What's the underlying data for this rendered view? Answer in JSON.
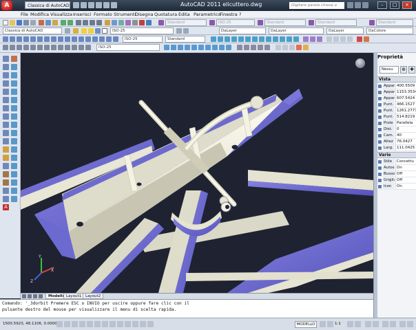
{
  "titlebar": {
    "app_button": "A",
    "workspace": "Classica di AutoCAD",
    "title": "AutoCAD 2011    elicuttero.dwg",
    "search_placeholder": "Digitare parola chiave o frase",
    "window_buttons": [
      "–",
      "□",
      "×"
    ]
  },
  "menubar": {
    "items": [
      "File",
      "Modifica",
      "Visualizza",
      "Inserisci",
      "Formato",
      "Strumenti",
      "Disegna",
      "Quotatura",
      "Edita",
      "Parametrico",
      "Finestra",
      "?"
    ]
  },
  "toolbars": {
    "workspace_combo": "Classica di AutoCAD",
    "text_style": "Standard",
    "dim_style": "ISO-25",
    "table_style": "Standard",
    "multileader_style": "Standard",
    "layer_combo": "DaLayer",
    "linetype_combo": "DaLayer",
    "lineweight_combo": "DaLayer",
    "color_combo": "DaColore",
    "row3_combo": "ISO-25",
    "row3_combo2": "Standard"
  },
  "viewport": {
    "background": "#1f2331",
    "shape_color": "#eeecd8",
    "accent_color": "#6b68cf"
  },
  "layout_tabs": [
    "Modello",
    "Layout1",
    "Layout2"
  ],
  "properties": {
    "header": "Proprietà",
    "selection": "Nessu",
    "categories": {
      "view": "Vista",
      "misc": "Varie"
    },
    "view_rows": [
      {
        "key": "Appar",
        "value": "400.5509"
      },
      {
        "key": "Appar",
        "value": "1153.3534"
      },
      {
        "key": "Appar",
        "value": "607.5424"
      },
      {
        "key": "Punt.",
        "value": "466.1527"
      },
      {
        "key": "Punt.",
        "value": "1261.2771"
      },
      {
        "key": "Punt.",
        "value": "514.8219"
      },
      {
        "key": "Proie",
        "value": "Parallela"
      },
      {
        "key": "Dist.",
        "value": "0"
      },
      {
        "key": "Cam.",
        "value": "40"
      },
      {
        "key": "Altez",
        "value": "76.0427"
      },
      {
        "key": "Larg.",
        "value": "111.0425"
      }
    ],
    "misc_rows": [
      {
        "key": "Stile",
        "value": "Concettu"
      },
      {
        "key": "Autos",
        "value": "On"
      },
      {
        "key": "Bussol",
        "value": "Off"
      },
      {
        "key": "Griglia",
        "value": "Off"
      },
      {
        "key": "Icon",
        "value": "On"
      }
    ]
  },
  "command": {
    "line1": "Comando: '_3dorbit Premere ESC o INVIO per uscire oppure fare clic con il",
    "line2": "pulsante destro del mouse per visualizzare il menu di scelta rapida."
  },
  "statusbar": {
    "coords": "1500.5923, 48.1106, 0.0000",
    "model": "MODELLO",
    "scale": "1:1"
  }
}
